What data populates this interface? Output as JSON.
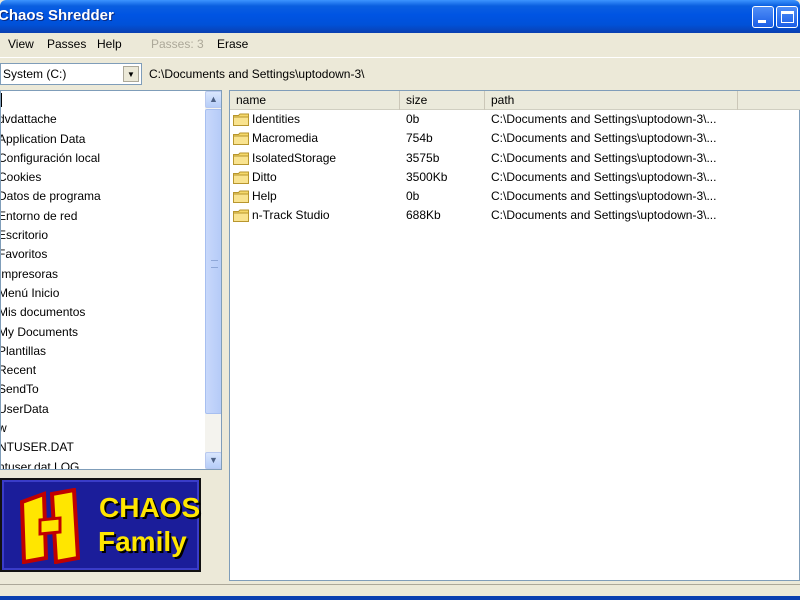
{
  "window": {
    "title": "Chaos Shredder"
  },
  "menu": {
    "items": [
      {
        "label": "View"
      },
      {
        "label": "Passes"
      },
      {
        "label": "Help"
      },
      {
        "label": "Passes: 3",
        "disabled": true
      },
      {
        "label": "Erase"
      }
    ]
  },
  "drive": {
    "selected": "System (C:)",
    "current_path": "C:\\Documents and Settings\\uptodown-3\\"
  },
  "left_list": {
    "items": [
      "",
      "dvdattache",
      "Application Data",
      "Configuración local",
      "Cookies",
      "Datos de programa",
      "Entorno de red",
      "Escritorio",
      "Favoritos",
      "Impresoras",
      "Menú Inicio",
      "Mis documentos",
      "My Documents",
      "Plantillas",
      "Recent",
      "SendTo",
      "UserData",
      "w",
      "NTUSER.DAT",
      "ntuser.dat.LOG"
    ]
  },
  "logo": {
    "line1": "CHAOS",
    "line2": "Family",
    "mark": "H"
  },
  "file_list": {
    "columns": [
      "name",
      "size",
      "path"
    ],
    "rows": [
      {
        "name": "Identities",
        "size": "0b",
        "path": "C:\\Documents and Settings\\uptodown-3\\..."
      },
      {
        "name": "Macromedia",
        "size": "754b",
        "path": "C:\\Documents and Settings\\uptodown-3\\..."
      },
      {
        "name": "IsolatedStorage",
        "size": "3575b",
        "path": "C:\\Documents and Settings\\uptodown-3\\..."
      },
      {
        "name": "Ditto",
        "size": "3500Kb",
        "path": "C:\\Documents and Settings\\uptodown-3\\..."
      },
      {
        "name": "Help",
        "size": "0b",
        "path": "C:\\Documents and Settings\\uptodown-3\\..."
      },
      {
        "name": "n-Track Studio",
        "size": "688Kb",
        "path": "C:\\Documents and Settings\\uptodown-3\\..."
      }
    ]
  },
  "colors": {
    "titlebar": "#0054e3",
    "window_bg": "#ECE9D8",
    "logo_bg": "#1b1d9a",
    "logo_text": "#ffe600",
    "folder": "#f5d86b"
  }
}
